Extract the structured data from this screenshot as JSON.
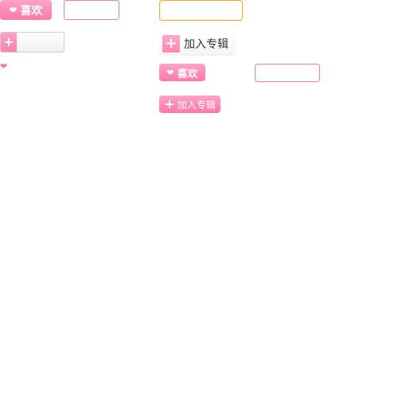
{
  "like_label": "喜欢",
  "add_album_label": "加入专辑",
  "plus_symbol": "+",
  "heart_symbol": "❤",
  "colors": {
    "pink": "#ff78a8",
    "orange": "#f5a623",
    "text": "#333333"
  }
}
